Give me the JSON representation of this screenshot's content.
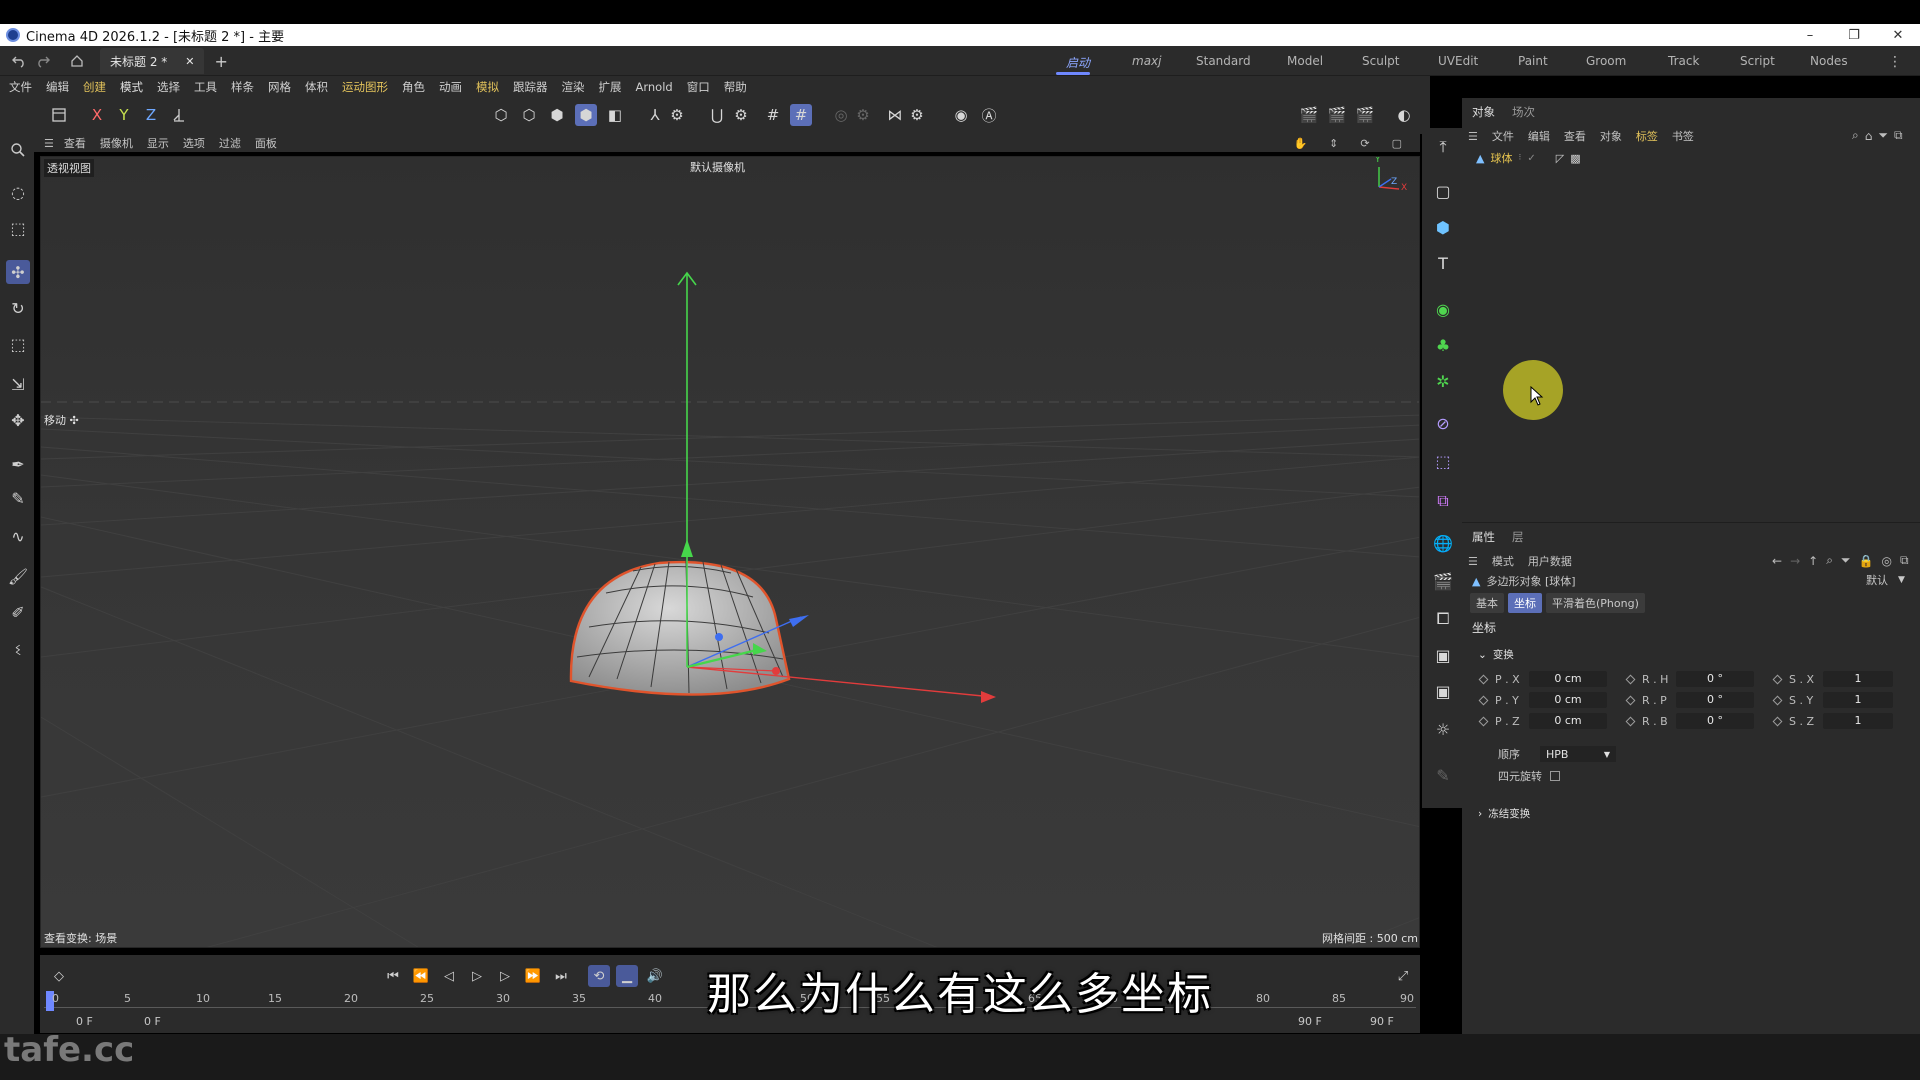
{
  "window": {
    "title": "Cinema 4D 2026.1.2 - [未标题 2 *] - 主要",
    "controls": [
      "–",
      "❐",
      "✕"
    ]
  },
  "tabs": {
    "doc_tab": "未标题 2 *",
    "close": "✕",
    "add": "+",
    "layouts": [
      "启动",
      "maxj",
      "Standard",
      "Model",
      "Sculpt",
      "UVEdit",
      "Paint",
      "Groom",
      "Track",
      "Script",
      "Nodes"
    ],
    "active_layout": "启动"
  },
  "menubar": [
    "文件",
    "编辑",
    "创建",
    "模式",
    "选择",
    "工具",
    "样条",
    "网格",
    "体积",
    "运动图形",
    "角色",
    "动画",
    "模拟",
    "跟踪器",
    "渲染",
    "扩展",
    "Arnold",
    "窗口",
    "帮助"
  ],
  "menubar_highlight": [
    "创建",
    "运动图形",
    "模拟"
  ],
  "toolbar": {
    "axis_x": "X",
    "axis_y": "Y",
    "axis_z": "Z"
  },
  "viewport": {
    "menu": [
      "查看",
      "摄像机",
      "显示",
      "选项",
      "过滤",
      "面板"
    ],
    "view_label": "透视视图",
    "camera_label": "默认摄像机 ",
    "tool_label": "移动 ✣",
    "status_left": "查看变换: 场景",
    "status_right": "网格间距 : 500 cm",
    "axis_y": "Y",
    "axis_x": "X",
    "axis_z": "Z"
  },
  "object_panel": {
    "tabs": [
      "对象",
      "场次"
    ],
    "menu": [
      "文件",
      "编辑",
      "查看",
      "对象",
      "标签",
      "书签"
    ],
    "menu_highlight": "标签",
    "object_name": "球体"
  },
  "attributes_panel": {
    "tabs": [
      "属性",
      "层"
    ],
    "menu": [
      "模式",
      "用户数据"
    ],
    "object_title": "多边形对象 [球体]",
    "preset": "默认",
    "subtabs": [
      "基本",
      "坐标",
      "平滑着色(Phong)"
    ],
    "active_subtab": "坐标",
    "section_title": "坐标",
    "group_transform": "变换",
    "rows": [
      [
        {
          "label": "P . X",
          "value": "0 cm"
        },
        {
          "label": "R . H",
          "value": "0 °"
        },
        {
          "label": "S . X",
          "value": "1"
        }
      ],
      [
        {
          "label": "P . Y",
          "value": "0 cm"
        },
        {
          "label": "R . P",
          "value": "0 °"
        },
        {
          "label": "S . Y",
          "value": "1"
        }
      ],
      [
        {
          "label": "P . Z",
          "value": "0 cm"
        },
        {
          "label": "R . B",
          "value": "0 °"
        },
        {
          "label": "S . Z",
          "value": "1"
        }
      ]
    ],
    "order_label": "顺序",
    "order_value": "HPB",
    "quat_label": "四元旋转",
    "freeze_label": "冻结变换"
  },
  "timeline": {
    "ticks": [
      "0",
      "5",
      "10",
      "15",
      "20",
      "25",
      "30",
      "35",
      "40",
      "45",
      "50",
      "55",
      "60",
      "65",
      "70",
      "75",
      "80",
      "85",
      "90"
    ],
    "start_frame": "0 F",
    "current_frame": "0 F",
    "end_frame": "90 F",
    "end_frame_2": "90 F"
  },
  "subtitle": "那么为什么有这么多坐标",
  "watermark": "tafe.cc",
  "colors": {
    "accent": "#6f88ff",
    "highlight_text": "#e3c35b",
    "y_axis": "#46d64b",
    "x_axis": "#e23c3c",
    "selection_outline": "#e0542c",
    "cursor_highlight": "#b4b026"
  }
}
